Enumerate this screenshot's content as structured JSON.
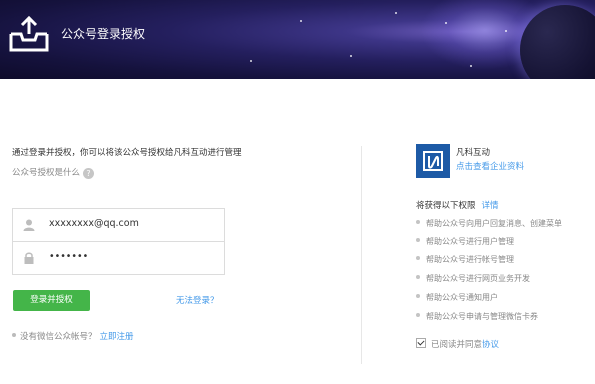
{
  "header": {
    "title": "公众号登录授权"
  },
  "login": {
    "description": "通过登录并授权，你可以将该公众号授权给凡科互动进行管理",
    "what_is_auth": "公众号授权是什么",
    "help_icon": "?",
    "username_value": "xxxxxxxx@qq.com",
    "password_value": "•••••••",
    "login_button": "登录并授权",
    "cannot_login": "无法登录？",
    "no_account_text": "没有微信公众帐号？",
    "register_link": "立即注册"
  },
  "app": {
    "name": "凡科互动",
    "details_link": "点击查看企业资料"
  },
  "permissions": {
    "title": "将获得以下权限",
    "details_link": "详情",
    "items": [
      "帮助公众号向用户回复消息、创建菜单",
      "帮助公众号进行用户管理",
      "帮助公众号进行帐号管理",
      "帮助公众号进行网页业务开发",
      "帮助公众号通知用户",
      "帮助公众号申请与管理微信卡券"
    ],
    "agree_text": "已阅读并同意",
    "agree_link": "协议"
  }
}
